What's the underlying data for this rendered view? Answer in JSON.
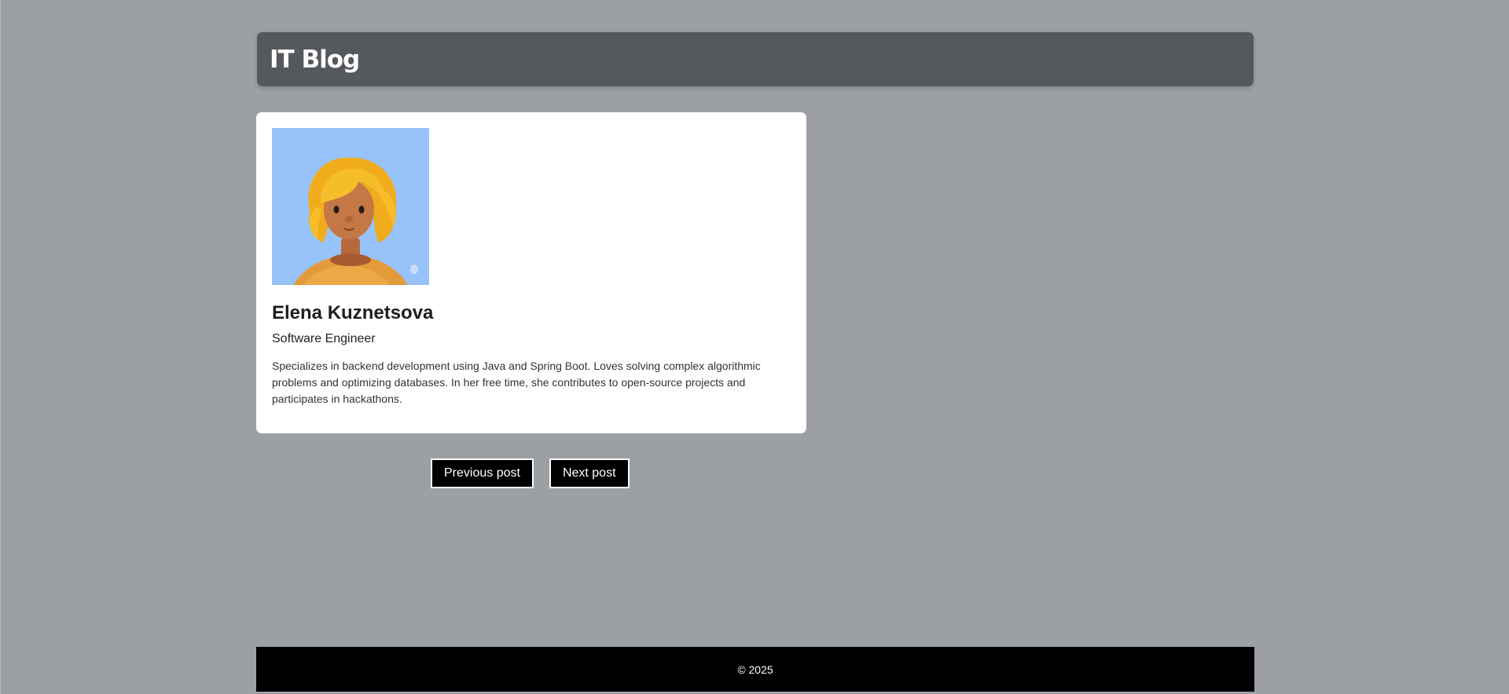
{
  "header": {
    "site_title": "IT Blog"
  },
  "profile": {
    "name": "Elena Kuznetsova",
    "role": "Software Engineer",
    "bio": "Specializes in backend development using Java and Spring Boot. Loves solving complex algorithmic problems and optimizing databases. In her free time, she contributes to open-source projects and participates in hackathons.",
    "avatar_icon": "avatar-3d-woman",
    "avatar_bg": "#97c2fa"
  },
  "pager": {
    "previous_label": "Previous post",
    "next_label": "Next post"
  },
  "footer": {
    "copyright": "© 2025"
  },
  "colors": {
    "page_bg": "#9c9fa3",
    "header_bg": "#55585c",
    "card_bg": "#ffffff",
    "button_bg": "#000000",
    "footer_bg": "#000000"
  }
}
